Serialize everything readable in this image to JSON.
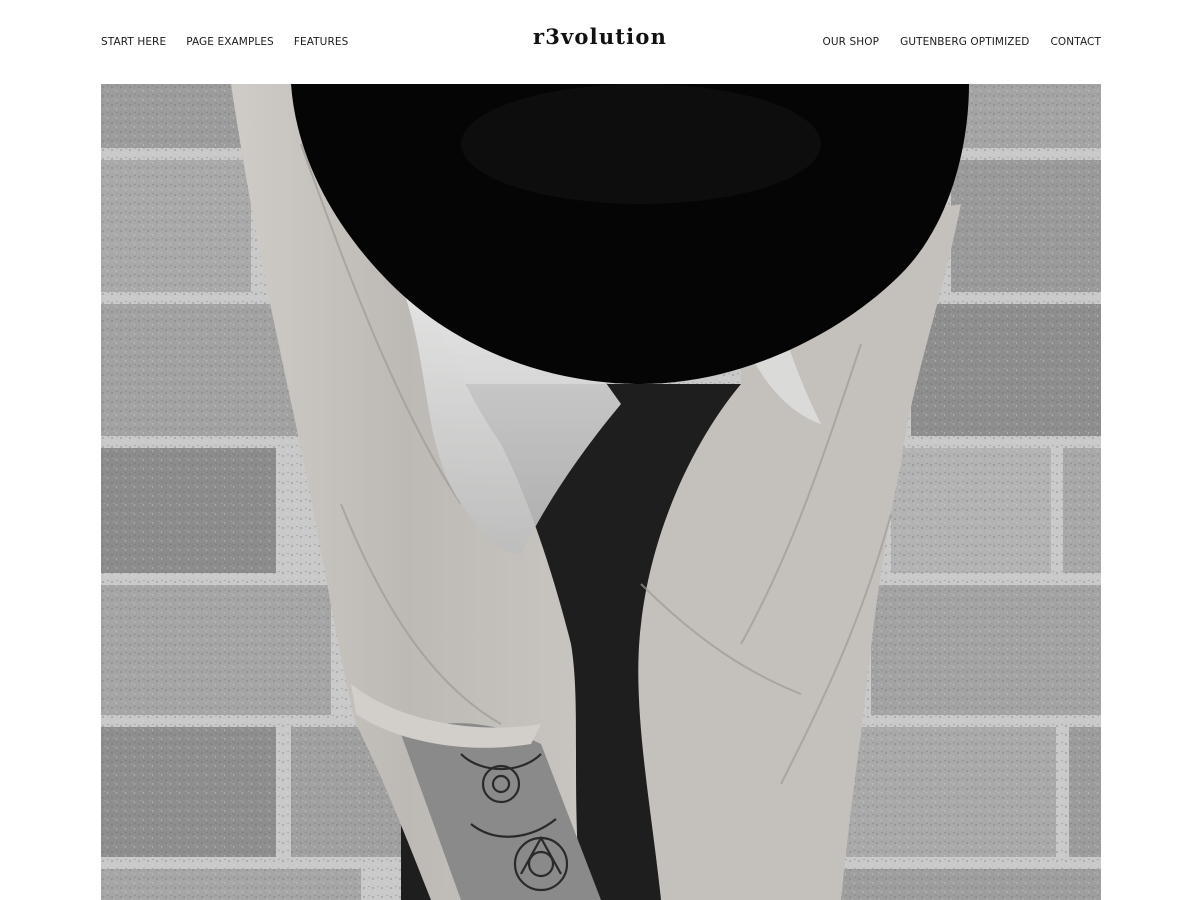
{
  "header": {
    "site_title": "r3volution",
    "nav_left": [
      {
        "label": "START HERE"
      },
      {
        "label": "PAGE EXAMPLES"
      },
      {
        "label": "FEATURES"
      }
    ],
    "nav_right": [
      {
        "label": "OUR SHOP"
      },
      {
        "label": "GUTENBERG OPTIMIZED"
      },
      {
        "label": "CONTACT"
      }
    ]
  },
  "hero": {
    "image_style": "black-and-white photograph",
    "subject_icon": "person-with-wide-brim-hat-photo"
  }
}
